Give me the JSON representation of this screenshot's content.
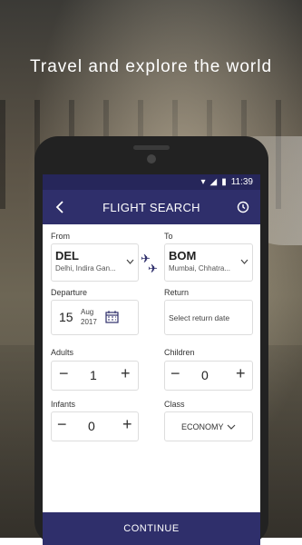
{
  "headline": "Travel and explore the world",
  "status": {
    "time": "11:39"
  },
  "appbar": {
    "title": "FLIGHT SEARCH"
  },
  "from": {
    "label": "From",
    "code": "DEL",
    "name": "Delhi, Indira Gan..."
  },
  "to": {
    "label": "To",
    "code": "BOM",
    "name": "Mumbai, Chhatra..."
  },
  "departure": {
    "label": "Departure",
    "day": "15",
    "month": "Aug",
    "year": "2017"
  },
  "return": {
    "label": "Return",
    "placeholder": "Select return date"
  },
  "adults": {
    "label": "Adults",
    "count": "1"
  },
  "children": {
    "label": "Children",
    "count": "0"
  },
  "infants": {
    "label": "Infants",
    "count": "0"
  },
  "class": {
    "label": "Class",
    "value": "ECONOMY"
  },
  "continue_label": "CONTINUE",
  "colors": {
    "primary": "#2f2f6b",
    "statusbar": "#26265a"
  }
}
